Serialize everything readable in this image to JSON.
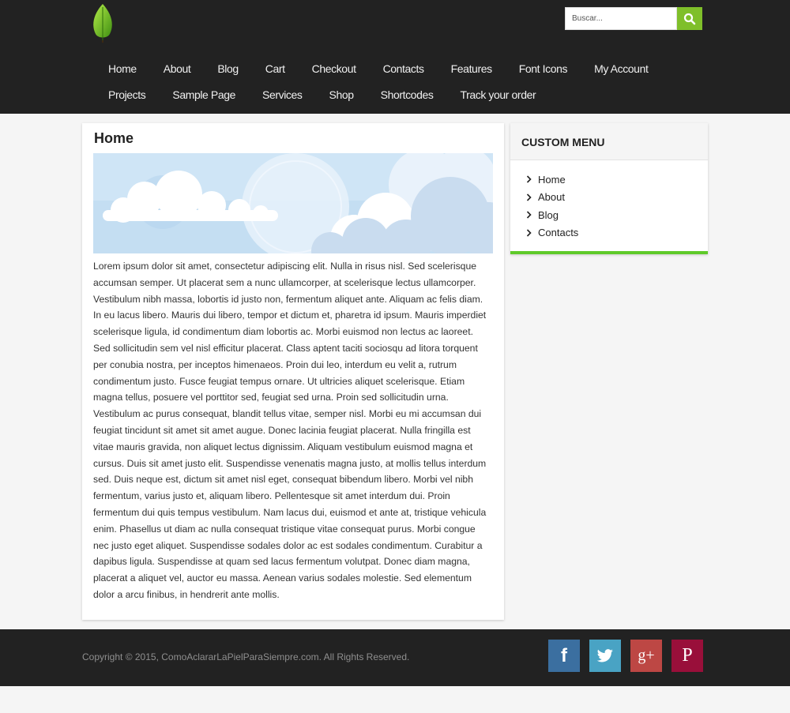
{
  "header": {
    "search_placeholder": "Buscar..."
  },
  "nav": {
    "row1": [
      "Home",
      "About",
      "Blog",
      "Cart",
      "Checkout",
      "Contacts",
      "Features",
      "Font Icons",
      "My Account"
    ],
    "row2": [
      "Projects",
      "Sample Page",
      "Services",
      "Shop",
      "Shortcodes",
      "Track your order"
    ]
  },
  "main": {
    "title": "Home",
    "body": "Lorem ipsum dolor sit amet, consectetur adipiscing elit. Nulla in risus nisl. Sed scelerisque accumsan semper. Ut placerat sem a nunc ullamcorper, at scelerisque lectus ullamcorper. Vestibulum nibh massa, lobortis id justo non, fermentum aliquet ante. Aliquam ac felis diam. In eu lacus libero. Mauris dui libero, tempor et dictum et, pharetra id ipsum. Mauris imperdiet scelerisque ligula, id condimentum diam lobortis ac. Morbi euismod non lectus ac laoreet. Sed sollicitudin sem vel nisl efficitur placerat. Class aptent taciti sociosqu ad litora torquent per conubia nostra, per inceptos himenaeos. Proin dui leo, interdum eu velit a, rutrum condimentum justo. Fusce feugiat tempus ornare. Ut ultricies aliquet scelerisque. Etiam magna tellus, posuere vel porttitor sed, feugiat sed urna. Proin sed sollicitudin urna. Vestibulum ac purus consequat, blandit tellus vitae, semper nisl. Morbi eu mi accumsan dui feugiat tincidunt sit amet sit amet augue. Donec lacinia feugiat placerat. Nulla fringilla est vitae mauris gravida, non aliquet lectus dignissim. Aliquam vestibulum euismod magna et cursus. Duis sit amet justo elit. Suspendisse venenatis magna justo, at mollis tellus interdum sed. Duis neque est, dictum sit amet nisl eget, consequat bibendum libero. Morbi vel nibh fermentum, varius justo et, aliquam libero. Pellentesque sit amet interdum dui. Proin fermentum dui quis tempus vestibulum. Nam lacus dui, euismod et ante at, tristique vehicula enim. Phasellus ut diam ac nulla consequat tristique vitae consequat purus. Morbi congue nec justo eget aliquet. Suspendisse sodales dolor ac est sodales condimentum. Curabitur a dapibus ligula. Suspendisse at quam sed lacus fermentum volutpat. Donec diam magna, placerat a aliquet vel, auctor eu massa. Aenean varius sodales molestie. Sed elementum dolor a arcu finibus, in hendrerit ante mollis."
  },
  "sidebar": {
    "title": "CUSTOM MENU",
    "items": [
      "Home",
      "About",
      "Blog",
      "Contacts"
    ]
  },
  "footer": {
    "copyright": "Copyright © 2015, ComoAclararLaPielParaSiempre.com. All Rights Reserved.",
    "social": [
      {
        "name": "facebook",
        "glyph": "f"
      },
      {
        "name": "twitter",
        "glyph": "twitter-bird"
      },
      {
        "name": "google-plus",
        "glyph": "g+"
      },
      {
        "name": "pinterest",
        "glyph": "P"
      }
    ]
  },
  "colors": {
    "header_bg": "#222222",
    "accent_green": "#7fbf2a",
    "widget_border": "#5fca2a",
    "facebook": "#3b6fa0",
    "twitter": "#49a3c4",
    "google_plus": "#bd4744",
    "pinterest": "#990f3a"
  }
}
